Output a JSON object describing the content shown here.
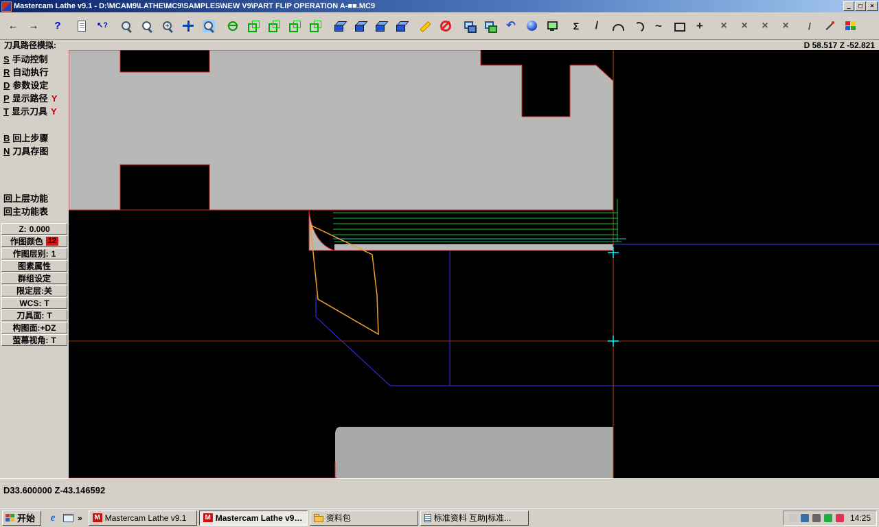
{
  "window": {
    "title": "Mastercam Lathe v9.1 - D:\\MCAM9\\LATHE\\MC9\\SAMPLES\\NEW V9\\PART FLIP OPERATION A-■■.MC9",
    "minimize": "_",
    "maximize": "□",
    "close": "×"
  },
  "toolbar": {
    "buttons": [
      {
        "name": "back-button",
        "glyph": "←",
        "fg": "#000000",
        "size": 15
      },
      {
        "name": "forward-button",
        "glyph": "→",
        "fg": "#000000",
        "size": 15,
        "gap": true
      },
      {
        "name": "help-button",
        "glyph": "?",
        "fg": "#0000cc",
        "size": 15,
        "gap": true
      },
      {
        "name": "notes-button",
        "shape": "doc"
      },
      {
        "name": "context-help-button",
        "glyph": "↖?",
        "fg": "#0000cc",
        "size": 11,
        "gap": true
      },
      {
        "name": "zoom-button",
        "shape": "magnifier"
      },
      {
        "name": "zoom-window-button",
        "shape": "magnifier-page"
      },
      {
        "name": "zoom-in-button",
        "shape": "magnifier-plus"
      },
      {
        "name": "pan-button",
        "shape": "pan"
      },
      {
        "name": "zoom-select-button",
        "shape": "magnifier-sel",
        "gap": true
      },
      {
        "name": "gview-dynamic-button",
        "shape": "globe"
      },
      {
        "name": "gview-top-button",
        "shape": "cube-green"
      },
      {
        "name": "gview-front-button",
        "shape": "cube-green"
      },
      {
        "name": "gview-side-button",
        "shape": "cube-green"
      },
      {
        "name": "gview-iso-button",
        "shape": "cube-green",
        "gap": true
      },
      {
        "name": "cplane-top-button",
        "shape": "cube-blue"
      },
      {
        "name": "cplane-front-button",
        "shape": "cube-blue"
      },
      {
        "name": "cplane-side-button",
        "shape": "cube-blue"
      },
      {
        "name": "cplane-3d-button",
        "shape": "cube-blue",
        "gap": true
      },
      {
        "name": "delete-button",
        "shape": "pencil"
      },
      {
        "name": "undelete-button",
        "shape": "noentry",
        "gap": true
      },
      {
        "name": "screen-blank-button",
        "shape": "screens"
      },
      {
        "name": "screen-fit-button",
        "shape": "screens2"
      },
      {
        "name": "undo-button",
        "glyph": "↶",
        "fg": "#2255cc",
        "size": 16
      },
      {
        "name": "shading-button",
        "shape": "sphere"
      },
      {
        "name": "screen-regen-button",
        "shape": "monitor-green",
        "gap": true
      },
      {
        "name": "analyze-button",
        "glyph": "Σ",
        "fg": "#000000",
        "size": 14
      },
      {
        "name": "line-button",
        "glyph": "/",
        "fg": "#222222",
        "size": 16
      },
      {
        "name": "arc-button",
        "shape": "arc"
      },
      {
        "name": "circle-button",
        "shape": "arc2"
      },
      {
        "name": "spline-button",
        "glyph": "~",
        "fg": "#222222",
        "size": 17
      },
      {
        "name": "rectangle-button",
        "shape": "rect"
      },
      {
        "name": "point-button",
        "glyph": "+",
        "fg": "#222222",
        "size": 17,
        "gap": true
      },
      {
        "name": "trim-button",
        "glyph": "×",
        "fg": "#555555",
        "size": 16
      },
      {
        "name": "break-button",
        "glyph": "×",
        "fg": "#555555",
        "size": 16
      },
      {
        "name": "join-button",
        "glyph": "×",
        "fg": "#555555",
        "size": 16
      },
      {
        "name": "modify-button",
        "glyph": "×",
        "fg": "#555555",
        "size": 16,
        "gap": true
      },
      {
        "name": "chamfer-button",
        "glyph": "/",
        "fg": "#444444",
        "size": 14
      },
      {
        "name": "fillet-button",
        "shape": "line-red"
      },
      {
        "name": "colors-button",
        "shape": "palette"
      }
    ]
  },
  "infobar": {
    "prompt": "刀具路径模拟:",
    "coords": "D 58.517  Z -52.821"
  },
  "sidebar": {
    "group1": [
      {
        "name": "manual-control",
        "hotkey": "S",
        "label": "手动控制"
      },
      {
        "name": "auto-run",
        "hotkey": "R",
        "label": "自动执行"
      },
      {
        "name": "set-parameters",
        "hotkey": "D",
        "label": "参数设定"
      },
      {
        "name": "show-path",
        "hotkey": "P",
        "label": "显示路径",
        "flag": "Y"
      },
      {
        "name": "show-tool",
        "hotkey": "T",
        "label": "显示刀具",
        "flag": "Y"
      }
    ],
    "group2": [
      {
        "name": "backup-step",
        "hotkey": "B",
        "label": "回上步骤"
      },
      {
        "name": "tool-snapshot",
        "hotkey": "N",
        "label": "刀具存图"
      }
    ],
    "group3": [
      {
        "name": "backup-menu",
        "label": "回上层功能"
      },
      {
        "name": "main-menu",
        "label": "回主功能表"
      }
    ],
    "buttons": [
      {
        "name": "z-depth",
        "label": "Z:",
        "value": "0.000"
      },
      {
        "name": "draw-color",
        "label": "作图颜色",
        "chip": "12",
        "chip_color": "#dd1111"
      },
      {
        "name": "draw-level",
        "label": "作图层别:",
        "value": "1"
      },
      {
        "name": "entity-attributes",
        "label": "图素属性"
      },
      {
        "name": "group-settings",
        "label": "群组设定"
      },
      {
        "name": "limit-level",
        "label": "限定层:关"
      },
      {
        "name": "wcs",
        "label": "WCS:",
        "value": "T"
      },
      {
        "name": "tool-plane",
        "label": "刀具面:",
        "value": "T"
      },
      {
        "name": "construction-plane",
        "label": "构图面:+DZ"
      },
      {
        "name": "screen-view",
        "label": "萤幕视角:",
        "value": "T"
      }
    ]
  },
  "canvas": {
    "colors": {
      "background": "#000000",
      "stock": "#b8b8b8",
      "chuck": "#a9a9a9",
      "stock_outline": "#dd2222",
      "toolpath": "#00cc44",
      "toolpath_alt": "#00cccc",
      "profile": "#3333ff",
      "tool": "#f0a030",
      "marker": "#00ffff",
      "centerline": "#993300",
      "axis": "#b34700",
      "dark_red": "#881111"
    }
  },
  "statusbar": {
    "coords": "D33.600000  Z-43.146592"
  },
  "taskbar": {
    "start_label": "开始",
    "ie_letter": "e",
    "quicklaunch_chevron": "»",
    "tasks": [
      {
        "name": "mastercam-1",
        "label": "Mastercam Lathe v9.1",
        "icon": "mastercam",
        "icon_letter": "M",
        "active": false
      },
      {
        "name": "mastercam-2",
        "label": "Mastercam Lathe v9....",
        "icon": "mastercam",
        "icon_letter": "M",
        "active": true
      },
      {
        "name": "folder",
        "label": "资料包",
        "icon": "folder",
        "active": false
      },
      {
        "name": "browser",
        "label": "标准资料 互助|标准...",
        "icon": "page",
        "active": false
      }
    ],
    "tray_icons": [
      {
        "name": "printer",
        "color": "#c8c8c8"
      },
      {
        "name": "input-method",
        "color": "#3a6ea5"
      },
      {
        "name": "volume",
        "color": "#666666"
      },
      {
        "name": "antivirus",
        "color": "#22aa44"
      },
      {
        "name": "downloader",
        "color": "#dd3355"
      }
    ],
    "clock": "14:25"
  }
}
